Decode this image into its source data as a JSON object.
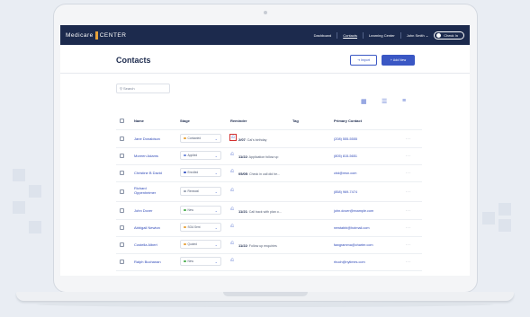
{
  "app": {
    "logo_left": "Medicare",
    "logo_right": "CENTER",
    "nav": [
      "Dashboard",
      "Contacts",
      "Learning Center",
      "John Smith"
    ],
    "active_nav": "Contacts",
    "checkin_label": "Check In"
  },
  "page": {
    "title": "Contacts",
    "import_label": "Import",
    "add_new_label": "Add New",
    "search_placeholder": "Search"
  },
  "table": {
    "headers": [
      "Name",
      "Stage",
      "Reminder",
      "Tag",
      "Primary Contact"
    ],
    "rows": [
      {
        "name": "Jane Donaldson",
        "stage": "Contacted",
        "stage_color": "#e7a23b",
        "reminder_date": "2/07",
        "reminder_text": "Cal's birthday",
        "contact": "(208) 555-5555",
        "bell_highlight": true
      },
      {
        "name": "Moreen Adams",
        "stage": "Applied",
        "stage_color": "#6b85d9",
        "reminder_date": "11/22",
        "reminder_text": "Application follow up",
        "contact": "(805) 815-5651",
        "bell_highlight": false
      },
      {
        "name": "Christine B David",
        "stage": "Enrolled",
        "stage_color": "#3a57c4",
        "reminder_date": "05/05",
        "reminder_text": "Check in call did he...",
        "contact": "cbd@msn.com",
        "bell_highlight": false
      },
      {
        "name_line1": "Richard",
        "name_line2": "Oppenheimer",
        "stage": "Renewal",
        "stage_color": "#9aa3b3",
        "reminder_date": "",
        "reminder_text": "",
        "contact": "(858) 969-7474",
        "bell_highlight": false
      },
      {
        "name": "John Dover",
        "stage": "New",
        "stage_color": "#4caf50",
        "reminder_date": "11/21",
        "reminder_text": "Call back with plan o...",
        "contact": "john.dover@example.com",
        "bell_highlight": false
      },
      {
        "name": "Abbigail Newton",
        "stage": "SOA Sent",
        "stage_color": "#e7a23b",
        "reminder_date": "",
        "reminder_text": "",
        "contact": "newtabbi@hotmail.com",
        "bell_highlight": false
      },
      {
        "name": "Costella Albert",
        "stage": "Quoted",
        "stage_color": "#e7a23b",
        "reminder_date": "11/22",
        "reminder_text": "Follow up enquiries",
        "contact": "fawgramma@charter.com",
        "bell_highlight": false
      },
      {
        "name": "Ralph Buchanan",
        "stage": "New",
        "stage_color": "#4caf50",
        "reminder_date": "",
        "reminder_text": "",
        "contact": "rbuch@nytimes.com",
        "bell_highlight": false
      }
    ]
  },
  "icons": {
    "search": "search-icon",
    "import": "import-icon",
    "add": "plus-icon",
    "bell": "bell-icon",
    "more": "more-icon"
  }
}
